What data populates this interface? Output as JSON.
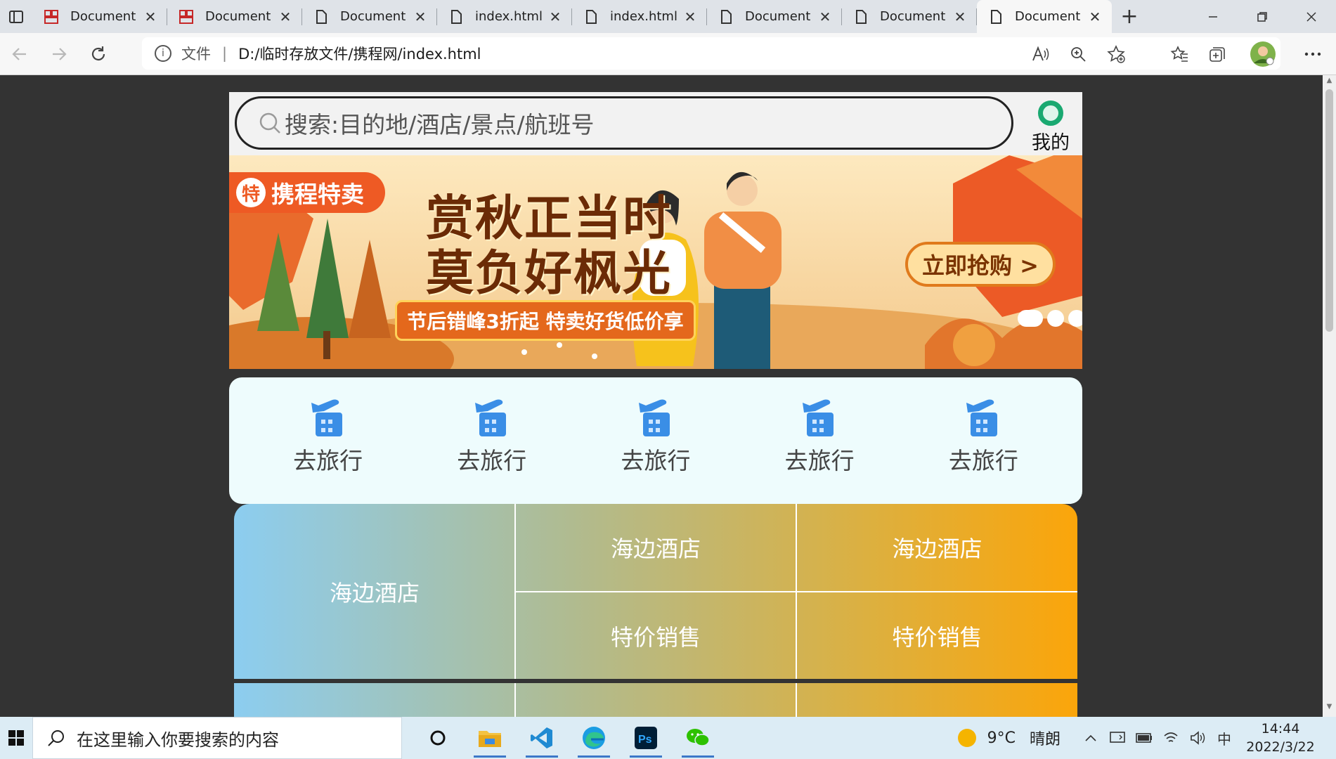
{
  "browser": {
    "tabs": [
      {
        "label": "Document",
        "icon": "grid-doc-icon",
        "active": false
      },
      {
        "label": "Document",
        "icon": "grid-doc-icon",
        "active": false
      },
      {
        "label": "Document",
        "icon": "page-icon",
        "active": false
      },
      {
        "label": "index.html",
        "icon": "page-icon",
        "active": false
      },
      {
        "label": "index.html",
        "icon": "page-icon",
        "active": false
      },
      {
        "label": "Document",
        "icon": "page-icon",
        "active": false
      },
      {
        "label": "Document",
        "icon": "page-icon",
        "active": false
      },
      {
        "label": "Document",
        "icon": "page-icon",
        "active": true
      }
    ],
    "close_glyph": "✕",
    "new_tab_glyph": "+",
    "address": {
      "scheme_label": "文件",
      "separator": "|",
      "url": "D:/临时存放文件/携程网/index.html"
    },
    "accent_color": "#1a73e8"
  },
  "page": {
    "search": {
      "placeholder": "搜索:目的地/酒店/景点/航班号"
    },
    "me_label": "我的",
    "banner": {
      "tag": "携程特卖",
      "tag_badge": "特",
      "headline_1": "赏秋正当时",
      "headline_2": "莫负好枫光",
      "subline": "节后错峰3折起 特卖好货低价享",
      "buy_button": "立即抢购 >",
      "slides": 3,
      "active_slide": 1
    },
    "quick_icons": [
      {
        "label": "去旅行",
        "icon": "plane-building-icon"
      },
      {
        "label": "去旅行",
        "icon": "plane-building-icon"
      },
      {
        "label": "去旅行",
        "icon": "plane-building-icon"
      },
      {
        "label": "去旅行",
        "icon": "plane-building-icon"
      },
      {
        "label": "去旅行",
        "icon": "plane-building-icon"
      }
    ],
    "grid": {
      "main": "海边酒店",
      "top": [
        "海边酒店",
        "海边酒店"
      ],
      "bottom": [
        "特价销售",
        "特价销售"
      ]
    },
    "colors": {
      "gradient_start": "#8ccdf0",
      "gradient_end": "#fba50a",
      "card_bg": "#eefcfd",
      "page_bg": "#333333"
    }
  },
  "taskbar": {
    "search_placeholder": "在这里输入你要搜索的内容",
    "weather_temp": "9°C",
    "weather_desc": "晴朗",
    "ime": "中",
    "time": "14:44",
    "date": "2022/3/22"
  }
}
